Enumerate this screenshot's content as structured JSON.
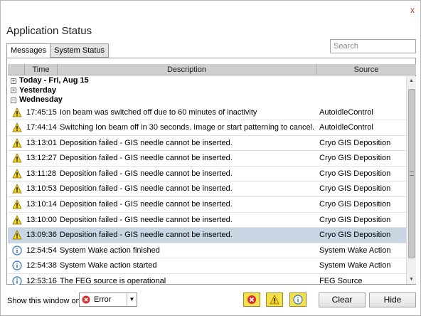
{
  "window": {
    "title": "Application Status",
    "close_glyph": "x"
  },
  "tabs": [
    {
      "label": "Messages",
      "active": true
    },
    {
      "label": "System Status",
      "active": false
    }
  ],
  "search": {
    "placeholder": "Search",
    "value": ""
  },
  "table": {
    "columns": [
      "Time",
      "Description",
      "Source"
    ],
    "groups": [
      {
        "label": "Today - Fri, Aug 15",
        "expander": "+"
      },
      {
        "label": "Yesterday",
        "expander": "+"
      },
      {
        "label": "Wednesday",
        "expander": "−"
      }
    ],
    "rows": [
      {
        "icon": "warning-icon",
        "time": "17:45:15",
        "description": "Ion beam was switched off due to 60 minutes of inactivity",
        "source": "AutoIdleControl",
        "selected": false
      },
      {
        "icon": "warning-icon",
        "time": "17:44:14",
        "description": "Switching Ion beam off in 30 seconds.  Image or start patterning to cancel.",
        "source": "AutoIdleControl",
        "selected": false
      },
      {
        "icon": "warning-icon",
        "time": "13:13:01",
        "description": "Deposition failed - GIS needle cannot be inserted.",
        "source": "Cryo GIS Deposition",
        "selected": false
      },
      {
        "icon": "warning-icon",
        "time": "13:12:27",
        "description": "Deposition failed - GIS needle cannot be inserted.",
        "source": "Cryo GIS Deposition",
        "selected": false
      },
      {
        "icon": "warning-icon",
        "time": "13:11:28",
        "description": "Deposition failed - GIS needle cannot be inserted.",
        "source": "Cryo GIS Deposition",
        "selected": false
      },
      {
        "icon": "warning-icon",
        "time": "13:10:53",
        "description": "Deposition failed - GIS needle cannot be inserted.",
        "source": "Cryo GIS Deposition",
        "selected": false
      },
      {
        "icon": "warning-icon",
        "time": "13:10:14",
        "description": "Deposition failed - GIS needle cannot be inserted.",
        "source": "Cryo GIS Deposition",
        "selected": false
      },
      {
        "icon": "warning-icon",
        "time": "13:10:00",
        "description": "Deposition failed - GIS needle cannot be inserted.",
        "source": "Cryo GIS Deposition",
        "selected": false
      },
      {
        "icon": "warning-icon",
        "time": "13:09:36",
        "description": "Deposition failed - GIS needle cannot be inserted.",
        "source": "Cryo GIS Deposition",
        "selected": true
      },
      {
        "icon": "info-icon",
        "time": "12:54:54",
        "description": "System Wake action finished",
        "source": "System Wake Action",
        "selected": false
      },
      {
        "icon": "info-icon",
        "time": "12:54:38",
        "description": "System Wake action started",
        "source": "System Wake Action",
        "selected": false
      },
      {
        "icon": "info-icon",
        "time": "12:53:16",
        "description": "The FEG source is operational",
        "source": "FEG Source",
        "selected": false
      }
    ]
  },
  "footer": {
    "show_label": "Show this window on",
    "severity_value": "Error",
    "filters": [
      "error-filter",
      "warning-filter",
      "info-filter"
    ],
    "clear_label": "Clear",
    "hide_label": "Hide"
  },
  "colors": {
    "selected_row": "#c9d6e4",
    "warning": "#f2d21b",
    "error": "#d32f2f",
    "info": "#2e6db4",
    "filter_button": "#f4e04d"
  }
}
